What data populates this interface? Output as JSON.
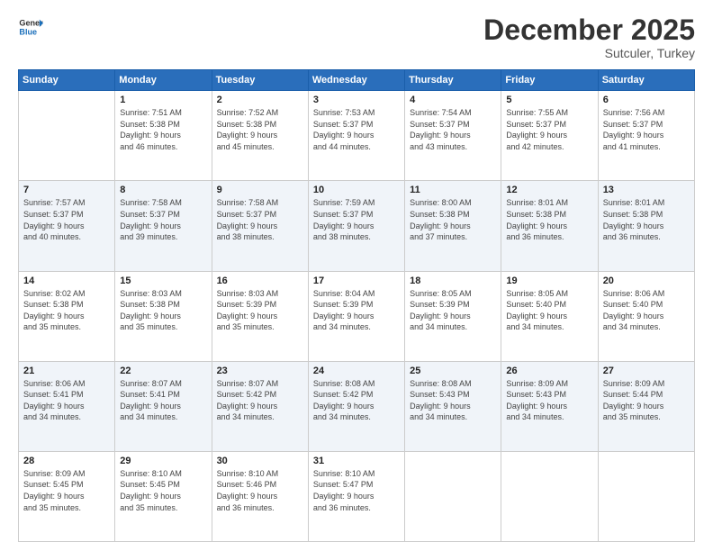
{
  "logo": {
    "text_general": "General",
    "text_blue": "Blue"
  },
  "header": {
    "month": "December 2025",
    "location": "Sutculer, Turkey"
  },
  "weekdays": [
    "Sunday",
    "Monday",
    "Tuesday",
    "Wednesday",
    "Thursday",
    "Friday",
    "Saturday"
  ],
  "weeks": [
    [
      {
        "day": "",
        "sunrise": "",
        "sunset": "",
        "daylight": ""
      },
      {
        "day": "1",
        "sunrise": "Sunrise: 7:51 AM",
        "sunset": "Sunset: 5:38 PM",
        "daylight": "Daylight: 9 hours and 46 minutes."
      },
      {
        "day": "2",
        "sunrise": "Sunrise: 7:52 AM",
        "sunset": "Sunset: 5:38 PM",
        "daylight": "Daylight: 9 hours and 45 minutes."
      },
      {
        "day": "3",
        "sunrise": "Sunrise: 7:53 AM",
        "sunset": "Sunset: 5:37 PM",
        "daylight": "Daylight: 9 hours and 44 minutes."
      },
      {
        "day": "4",
        "sunrise": "Sunrise: 7:54 AM",
        "sunset": "Sunset: 5:37 PM",
        "daylight": "Daylight: 9 hours and 43 minutes."
      },
      {
        "day": "5",
        "sunrise": "Sunrise: 7:55 AM",
        "sunset": "Sunset: 5:37 PM",
        "daylight": "Daylight: 9 hours and 42 minutes."
      },
      {
        "day": "6",
        "sunrise": "Sunrise: 7:56 AM",
        "sunset": "Sunset: 5:37 PM",
        "daylight": "Daylight: 9 hours and 41 minutes."
      }
    ],
    [
      {
        "day": "7",
        "sunrise": "Sunrise: 7:57 AM",
        "sunset": "Sunset: 5:37 PM",
        "daylight": "Daylight: 9 hours and 40 minutes."
      },
      {
        "day": "8",
        "sunrise": "Sunrise: 7:58 AM",
        "sunset": "Sunset: 5:37 PM",
        "daylight": "Daylight: 9 hours and 39 minutes."
      },
      {
        "day": "9",
        "sunrise": "Sunrise: 7:58 AM",
        "sunset": "Sunset: 5:37 PM",
        "daylight": "Daylight: 9 hours and 38 minutes."
      },
      {
        "day": "10",
        "sunrise": "Sunrise: 7:59 AM",
        "sunset": "Sunset: 5:37 PM",
        "daylight": "Daylight: 9 hours and 38 minutes."
      },
      {
        "day": "11",
        "sunrise": "Sunrise: 8:00 AM",
        "sunset": "Sunset: 5:38 PM",
        "daylight": "Daylight: 9 hours and 37 minutes."
      },
      {
        "day": "12",
        "sunrise": "Sunrise: 8:01 AM",
        "sunset": "Sunset: 5:38 PM",
        "daylight": "Daylight: 9 hours and 36 minutes."
      },
      {
        "day": "13",
        "sunrise": "Sunrise: 8:01 AM",
        "sunset": "Sunset: 5:38 PM",
        "daylight": "Daylight: 9 hours and 36 minutes."
      }
    ],
    [
      {
        "day": "14",
        "sunrise": "Sunrise: 8:02 AM",
        "sunset": "Sunset: 5:38 PM",
        "daylight": "Daylight: 9 hours and 35 minutes."
      },
      {
        "day": "15",
        "sunrise": "Sunrise: 8:03 AM",
        "sunset": "Sunset: 5:38 PM",
        "daylight": "Daylight: 9 hours and 35 minutes."
      },
      {
        "day": "16",
        "sunrise": "Sunrise: 8:03 AM",
        "sunset": "Sunset: 5:39 PM",
        "daylight": "Daylight: 9 hours and 35 minutes."
      },
      {
        "day": "17",
        "sunrise": "Sunrise: 8:04 AM",
        "sunset": "Sunset: 5:39 PM",
        "daylight": "Daylight: 9 hours and 34 minutes."
      },
      {
        "day": "18",
        "sunrise": "Sunrise: 8:05 AM",
        "sunset": "Sunset: 5:39 PM",
        "daylight": "Daylight: 9 hours and 34 minutes."
      },
      {
        "day": "19",
        "sunrise": "Sunrise: 8:05 AM",
        "sunset": "Sunset: 5:40 PM",
        "daylight": "Daylight: 9 hours and 34 minutes."
      },
      {
        "day": "20",
        "sunrise": "Sunrise: 8:06 AM",
        "sunset": "Sunset: 5:40 PM",
        "daylight": "Daylight: 9 hours and 34 minutes."
      }
    ],
    [
      {
        "day": "21",
        "sunrise": "Sunrise: 8:06 AM",
        "sunset": "Sunset: 5:41 PM",
        "daylight": "Daylight: 9 hours and 34 minutes."
      },
      {
        "day": "22",
        "sunrise": "Sunrise: 8:07 AM",
        "sunset": "Sunset: 5:41 PM",
        "daylight": "Daylight: 9 hours and 34 minutes."
      },
      {
        "day": "23",
        "sunrise": "Sunrise: 8:07 AM",
        "sunset": "Sunset: 5:42 PM",
        "daylight": "Daylight: 9 hours and 34 minutes."
      },
      {
        "day": "24",
        "sunrise": "Sunrise: 8:08 AM",
        "sunset": "Sunset: 5:42 PM",
        "daylight": "Daylight: 9 hours and 34 minutes."
      },
      {
        "day": "25",
        "sunrise": "Sunrise: 8:08 AM",
        "sunset": "Sunset: 5:43 PM",
        "daylight": "Daylight: 9 hours and 34 minutes."
      },
      {
        "day": "26",
        "sunrise": "Sunrise: 8:09 AM",
        "sunset": "Sunset: 5:43 PM",
        "daylight": "Daylight: 9 hours and 34 minutes."
      },
      {
        "day": "27",
        "sunrise": "Sunrise: 8:09 AM",
        "sunset": "Sunset: 5:44 PM",
        "daylight": "Daylight: 9 hours and 35 minutes."
      }
    ],
    [
      {
        "day": "28",
        "sunrise": "Sunrise: 8:09 AM",
        "sunset": "Sunset: 5:45 PM",
        "daylight": "Daylight: 9 hours and 35 minutes."
      },
      {
        "day": "29",
        "sunrise": "Sunrise: 8:10 AM",
        "sunset": "Sunset: 5:45 PM",
        "daylight": "Daylight: 9 hours and 35 minutes."
      },
      {
        "day": "30",
        "sunrise": "Sunrise: 8:10 AM",
        "sunset": "Sunset: 5:46 PM",
        "daylight": "Daylight: 9 hours and 36 minutes."
      },
      {
        "day": "31",
        "sunrise": "Sunrise: 8:10 AM",
        "sunset": "Sunset: 5:47 PM",
        "daylight": "Daylight: 9 hours and 36 minutes."
      },
      {
        "day": "",
        "sunrise": "",
        "sunset": "",
        "daylight": ""
      },
      {
        "day": "",
        "sunrise": "",
        "sunset": "",
        "daylight": ""
      },
      {
        "day": "",
        "sunrise": "",
        "sunset": "",
        "daylight": ""
      }
    ]
  ]
}
